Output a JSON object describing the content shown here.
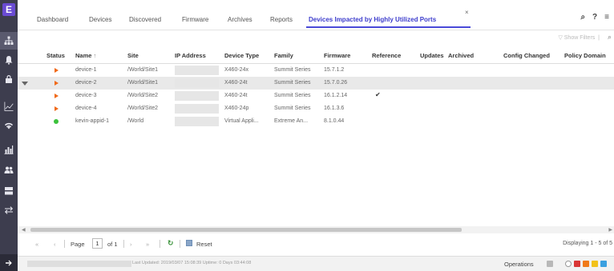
{
  "app": {
    "logo_letter": "E"
  },
  "tabs": [
    {
      "label": "Dashboard"
    },
    {
      "label": "Devices"
    },
    {
      "label": "Discovered"
    },
    {
      "label": "Firmware"
    },
    {
      "label": "Archives"
    },
    {
      "label": "Reports"
    },
    {
      "label": "Devices Impacted by Highly Utilized Ports",
      "active": true,
      "close": "×"
    }
  ],
  "toolbar": {
    "show_filters": "Show Filters"
  },
  "table": {
    "columns": [
      "Status",
      "Name",
      "Site",
      "IP Address",
      "Device Type",
      "Family",
      "Firmware",
      "Reference",
      "Updates",
      "Archived",
      "Config Changed",
      "Policy Domain"
    ],
    "sort_indicator": "↑",
    "rows": [
      {
        "status": "orange",
        "name": "device-1",
        "site": "/World/Site1",
        "ip": "",
        "device_type": "X460-24x",
        "family": "Summit Series",
        "firmware": "15.7.1.2",
        "reference": "",
        "selected": false
      },
      {
        "status": "orange",
        "name": "device-2",
        "site": "/World/Site1",
        "ip": "",
        "device_type": "X460-24t",
        "family": "Summit Series",
        "firmware": "15.7.0.26",
        "reference": "",
        "selected": true
      },
      {
        "status": "orange",
        "name": "device-3",
        "site": "/World/Site2",
        "ip": "",
        "device_type": "X460-24t",
        "family": "Summit Series",
        "firmware": "16.1.2.14",
        "reference": "✔",
        "selected": false
      },
      {
        "status": "orange",
        "name": "device-4",
        "site": "/World/Site2",
        "ip": "",
        "device_type": "X460-24p",
        "family": "Summit Series",
        "firmware": "16.1.3.6",
        "reference": "",
        "selected": false
      },
      {
        "status": "green",
        "name": "kevin-appid-1",
        "site": "/World",
        "ip": "",
        "device_type": "Virtual Appli...",
        "family": "Extreme An...",
        "firmware": "8.1.0.44",
        "reference": "",
        "selected": false
      }
    ]
  },
  "pager": {
    "page_label": "Page",
    "page_value": "1",
    "of_label": "of 1",
    "reset_label": "Reset",
    "displaying": "Displaying 1 - 5 of 5"
  },
  "statusbar": {
    "text": "Last Updated: 2019/03/07 15:08:39  Uptime: 0 Days 03:44:08",
    "operations": "Operations"
  },
  "colors": {
    "sidebar": "#3d3d4e",
    "accent": "#4a4ad8",
    "status_orange": "#f06a1a",
    "status_green": "#3bc23b"
  }
}
